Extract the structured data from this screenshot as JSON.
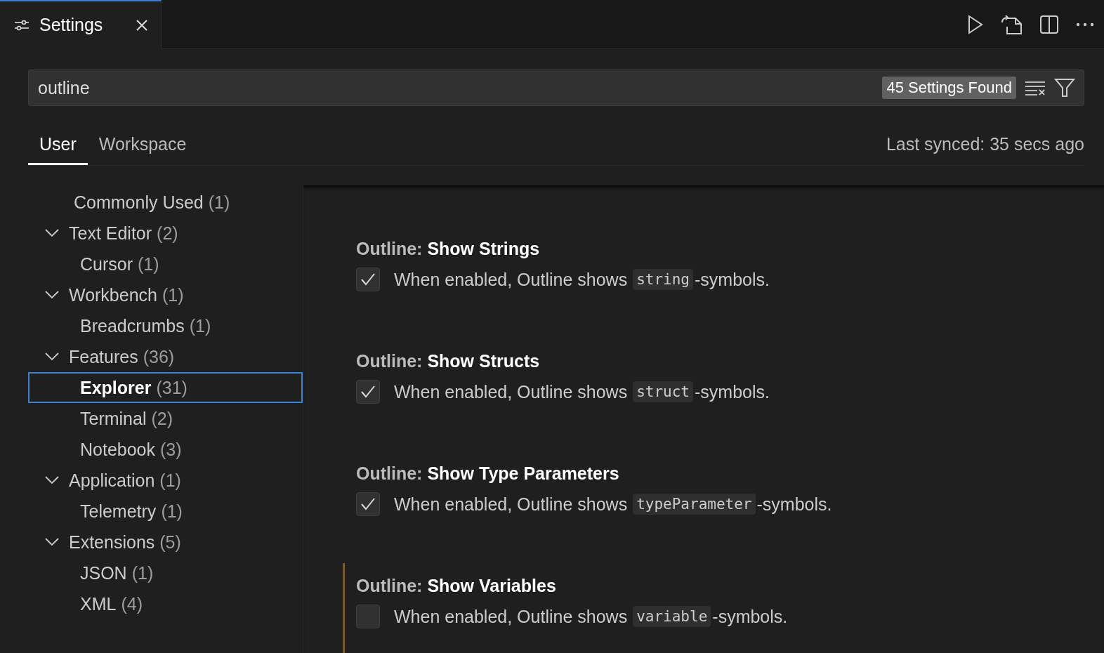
{
  "editor_tab": {
    "title": "Settings",
    "selected": true
  },
  "search": {
    "value": "outline",
    "results_badge": "45 Settings Found"
  },
  "scope_tabs": [
    {
      "label": "User",
      "selected": true
    },
    {
      "label": "Workspace",
      "selected": false
    }
  ],
  "sync_status": "Last synced: 35 secs ago",
  "tree": [
    {
      "label": "Commonly Used",
      "count": "(1)",
      "selected": false
    },
    {
      "label": "Text Editor",
      "count": "(2)",
      "selected": false,
      "expanded": true,
      "children": [
        {
          "label": "Cursor",
          "count": "(1)",
          "selected": false
        }
      ]
    },
    {
      "label": "Workbench",
      "count": "(1)",
      "selected": false,
      "expanded": true,
      "children": [
        {
          "label": "Breadcrumbs",
          "count": "(1)",
          "selected": false
        }
      ]
    },
    {
      "label": "Features",
      "count": "(36)",
      "selected": false,
      "expanded": true,
      "children": [
        {
          "label": "Explorer",
          "count": "(31)",
          "selected": true
        },
        {
          "label": "Terminal",
          "count": "(2)",
          "selected": false
        },
        {
          "label": "Notebook",
          "count": "(3)",
          "selected": false
        }
      ]
    },
    {
      "label": "Application",
      "count": "(1)",
      "selected": false,
      "expanded": true,
      "children": [
        {
          "label": "Telemetry",
          "count": "(1)",
          "selected": false
        }
      ]
    },
    {
      "label": "Extensions",
      "count": "(5)",
      "selected": false,
      "expanded": true,
      "children": [
        {
          "label": "JSON",
          "count": "(1)",
          "selected": false
        },
        {
          "label": "XML",
          "count": "(4)",
          "selected": false
        }
      ]
    }
  ],
  "settings": [
    {
      "category": "Outline:",
      "name": "Show Strings",
      "checked": true,
      "modified": false,
      "prefix": "When enabled, Outline shows",
      "code": "string",
      "suffix": "-symbols."
    },
    {
      "category": "Outline:",
      "name": "Show Structs",
      "checked": true,
      "modified": false,
      "prefix": "When enabled, Outline shows",
      "code": "struct",
      "suffix": "-symbols."
    },
    {
      "category": "Outline:",
      "name": "Show Type Parameters",
      "checked": true,
      "modified": false,
      "prefix": "When enabled, Outline shows",
      "code": "typeParameter",
      "suffix": "-symbols."
    },
    {
      "category": "Outline:",
      "name": "Show Variables",
      "checked": false,
      "modified": true,
      "prefix": "When enabled, Outline shows",
      "code": "variable",
      "suffix": "-symbols."
    }
  ]
}
